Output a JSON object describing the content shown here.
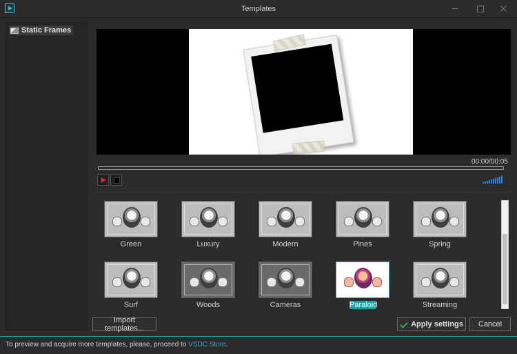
{
  "window": {
    "title": "Templates"
  },
  "sidebar": {
    "items": [
      {
        "label": "Static Frames",
        "icon": "frame-icon"
      }
    ]
  },
  "player": {
    "time": "00:00/00:05",
    "progress": 0
  },
  "templates": [
    {
      "label": "Green",
      "selected": false
    },
    {
      "label": "Luxury",
      "selected": false
    },
    {
      "label": "Modern",
      "selected": false
    },
    {
      "label": "Pines",
      "selected": false
    },
    {
      "label": "Spring",
      "selected": false
    },
    {
      "label": "Surf",
      "selected": false
    },
    {
      "label": "Woods",
      "selected": false
    },
    {
      "label": "Cameras",
      "selected": false
    },
    {
      "label": "Paraloid",
      "selected": true
    },
    {
      "label": "Streaming",
      "selected": false
    }
  ],
  "buttons": {
    "import": "Import templates...",
    "apply": "Apply settings",
    "cancel": "Cancel"
  },
  "footer": {
    "text": "To preview and acquire more templates, please, proceed to ",
    "link": "VSDC Store",
    "end": "."
  },
  "colors": {
    "accent": "#1aa3a9",
    "link": "#3aa4d4",
    "play": "#e8213b",
    "volume": "#2f7fd8",
    "apply_check": "#2fb24a"
  }
}
